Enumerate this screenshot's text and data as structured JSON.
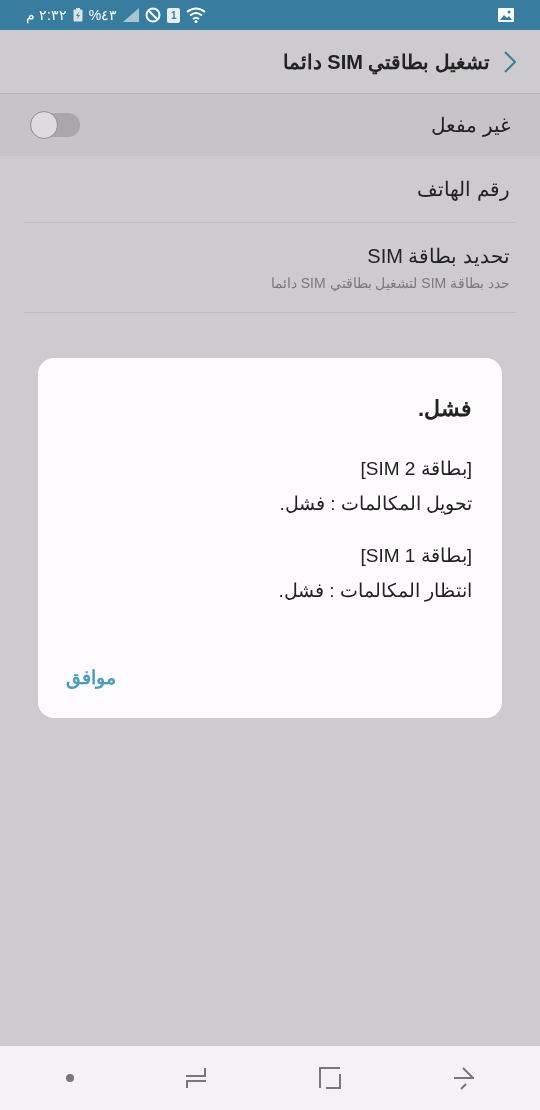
{
  "status_bar": {
    "time": "٢:٣٢ م",
    "battery": "٤٣%",
    "sim_slot": "1"
  },
  "header": {
    "title": "تشغيل بطاقتي SIM دائما"
  },
  "master_switch": {
    "label": "غير مفعل",
    "on": false
  },
  "settings": [
    {
      "title": "رقم الهاتف"
    },
    {
      "title": "تحديد بطاقة SIM",
      "subtitle": "حدد بطاقة SIM لتشغيل بطاقتي SIM دائما"
    }
  ],
  "dialog": {
    "title": "فشل.",
    "messages": [
      {
        "heading": "[بطاقة SIM 2]",
        "text": "تحويل المكالمات : فشل."
      },
      {
        "heading": "[بطاقة SIM 1]",
        "text": "انتظار المكالمات : فشل."
      }
    ],
    "button": "موافق"
  }
}
